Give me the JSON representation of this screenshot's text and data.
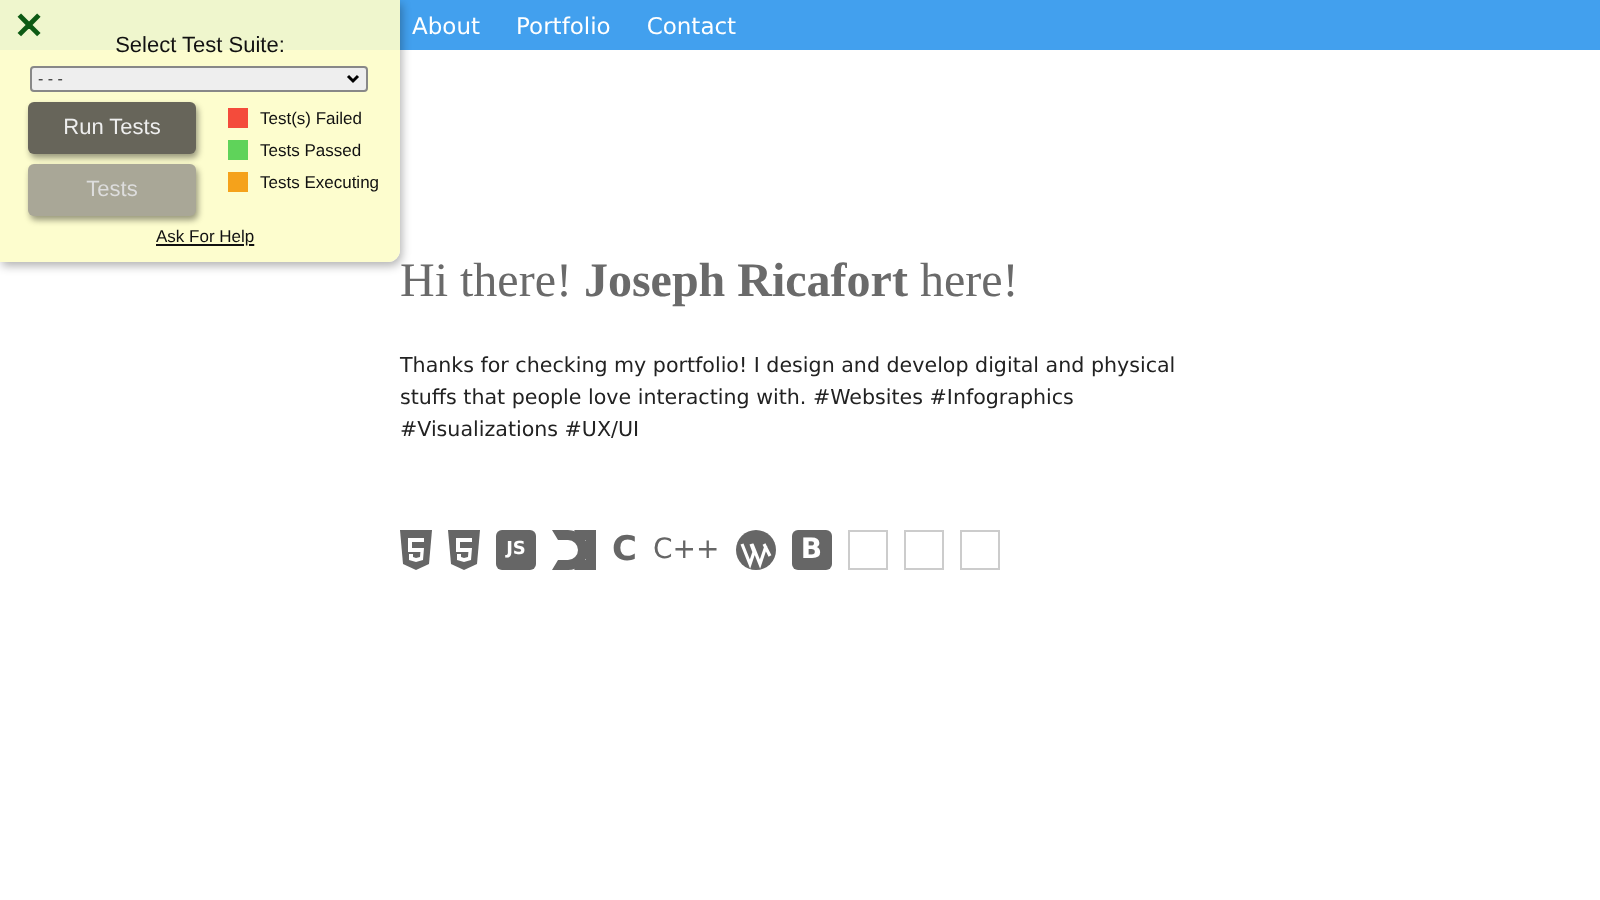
{
  "nav": {
    "links": [
      "About",
      "Portfolio",
      "Contact"
    ]
  },
  "test_panel": {
    "close": "✕",
    "title": "Select Test Suite:",
    "select": {
      "value": "- - -"
    },
    "buttons": [
      {
        "label": "Run Tests",
        "kind": "primary"
      },
      {
        "label": "Tests",
        "kind": "secondary"
      }
    ],
    "legend": [
      {
        "label": "Test(s) Failed",
        "color": "#f44b3b"
      },
      {
        "label": "Tests Passed",
        "color": "#5fd35a"
      },
      {
        "label": "Tests Executing",
        "color": "#f5a21b"
      }
    ],
    "help_link": "Ask For Help"
  },
  "hero": {
    "heading": "Hi there! **Joseph Ricafort** here!",
    "intro": "Thanks for checking my portfolio! I design and develop digital and physical stuffs that people love interacting with. #Websites #Infographics #Visualizations #UX/UI"
  },
  "skills": [
    {
      "kind": "html5"
    },
    {
      "kind": "css3"
    },
    {
      "kind": "badge",
      "glyph": "JS"
    },
    {
      "kind": "d3"
    },
    {
      "kind": "letter",
      "glyph": "C"
    },
    {
      "kind": "letter",
      "glyph": "C++"
    },
    {
      "kind": "wordpress"
    },
    {
      "kind": "badge",
      "glyph": "B"
    },
    {
      "kind": "broken-image"
    },
    {
      "kind": "broken-image"
    },
    {
      "kind": "broken-image"
    }
  ]
}
